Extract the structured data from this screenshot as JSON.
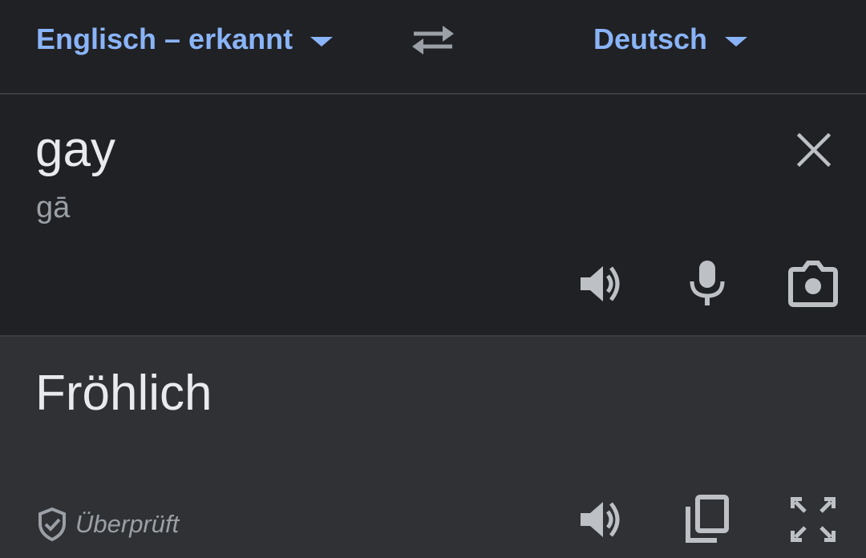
{
  "header": {
    "source_language": "Englisch – erkannt",
    "target_language": "Deutsch"
  },
  "input": {
    "text": "gay",
    "phonetic": "gā"
  },
  "output": {
    "text": "Fröhlich",
    "verified_label": "Überprüft"
  },
  "colors": {
    "accent": "#8ab4f8",
    "background": "#202124",
    "output_background": "#303134",
    "icon": "#bdc1c6"
  },
  "icons": {
    "swap": "swap-languages-icon",
    "clear": "close-icon",
    "listen_source": "speaker-icon",
    "mic": "microphone-icon",
    "camera": "camera-icon",
    "listen_output": "speaker-icon",
    "copy": "copy-icon",
    "fullscreen": "fullscreen-icon",
    "verified": "shield-check-icon"
  }
}
